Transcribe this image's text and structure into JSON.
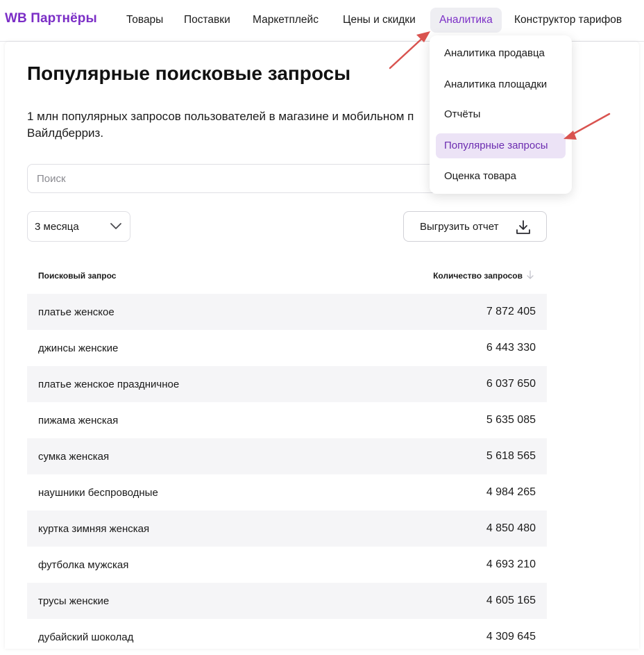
{
  "nav": {
    "logo": "WB Партнёры",
    "items": [
      "Товары",
      "Поставки",
      "Маркетплейс",
      "Цены и скидки",
      "Аналитика",
      "Конструктор тарифов"
    ],
    "active_index": 4
  },
  "page": {
    "title": "Популярные поисковые запросы",
    "description": "1 млн популярных запросов пользователей в магазине и мобильном п",
    "description_line2": "Вайлдберриз."
  },
  "search": {
    "placeholder": "Поиск",
    "value": ""
  },
  "period": {
    "selected": "3 месяца"
  },
  "export": {
    "label": "Выгрузить отчет"
  },
  "table": {
    "columns": [
      "Поисковый запрос",
      "Количество запросов"
    ],
    "rows": [
      {
        "query": "платье женское",
        "count": "7 872 405"
      },
      {
        "query": "джинсы женские",
        "count": "6 443 330"
      },
      {
        "query": "платье женское праздничное",
        "count": "6 037 650"
      },
      {
        "query": "пижама женская",
        "count": "5 635 085"
      },
      {
        "query": "сумка женская",
        "count": "5 618 565"
      },
      {
        "query": "наушники беспроводные",
        "count": "4 984 265"
      },
      {
        "query": "куртка зимняя женская",
        "count": "4 850 480"
      },
      {
        "query": "футболка мужская",
        "count": "4 693 210"
      },
      {
        "query": "трусы женские",
        "count": "4 605 165"
      },
      {
        "query": "дубайский шоколад",
        "count": "4 309 645"
      }
    ]
  },
  "dropdown": {
    "items": [
      "Аналитика продавца",
      "Аналитика площадки",
      "Отчёты",
      "Популярные запросы",
      "Оценка товара"
    ],
    "active_index": 3
  },
  "colors": {
    "brand": "#7b2ec6",
    "active_bg": "#ece3f6",
    "annotation_arrow": "#d9534f"
  }
}
